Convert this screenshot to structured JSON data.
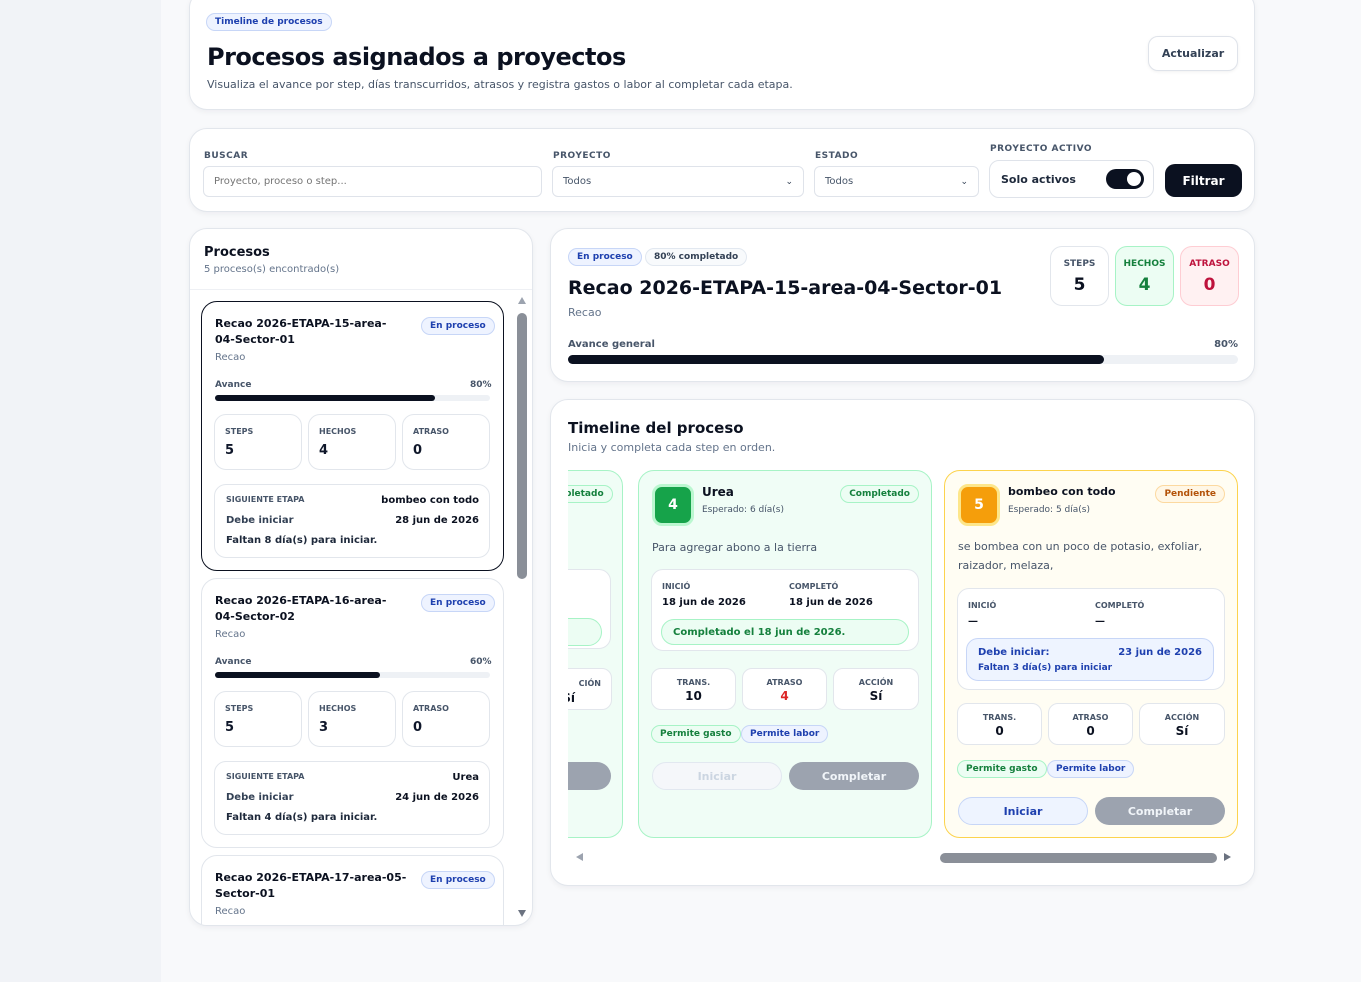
{
  "header": {
    "badge": "Timeline de procesos",
    "title": "Procesos asignados a proyectos",
    "subtitle": "Visualiza el avance por step, días transcurridos, atrasos y registra gastos o labor al completar cada etapa.",
    "refresh_label": "Actualizar"
  },
  "filters": {
    "search_label": "BUSCAR",
    "search_placeholder": "Proyecto, proceso o step...",
    "project_label": "PROYECTO",
    "project_value": "Todos",
    "state_label": "ESTADO",
    "state_value": "Todos",
    "active_label": "PROYECTO ACTIVO",
    "active_toggle_label": "Solo activos",
    "active_on": true,
    "filter_label": "Filtrar"
  },
  "process_list": {
    "title": "Procesos",
    "count_text": "5 proceso(s) encontrado(s)",
    "progress_label": "Avance",
    "next_label": "SIGUIENTE ETAPA",
    "must_start_label": "Debe iniciar",
    "stat_labels": {
      "steps": "STEPS",
      "done": "HECHOS",
      "delay": "ATRASO"
    },
    "items": [
      {
        "name": "Recao 2026-ETAPA-15-area-04-Sector-01",
        "status": "En proceso",
        "subtitle": "Recao",
        "progress_text": "80%",
        "progress": 0.8,
        "steps": "5",
        "done": "4",
        "delay": "0",
        "next_step": "bombeo con todo",
        "start_date": "28 jun de 2026",
        "remaining": "Faltan 8 día(s) para iniciar."
      },
      {
        "name": "Recao 2026-ETAPA-16-area-04-Sector-02",
        "status": "En proceso",
        "subtitle": "Recao",
        "progress_text": "60%",
        "progress": 0.6,
        "steps": "5",
        "done": "3",
        "delay": "0",
        "next_step": "Urea",
        "start_date": "24 jun de 2026",
        "remaining": "Faltan 4 día(s) para iniciar."
      },
      {
        "name": "Recao 2026-ETAPA-17-area-05-Sector-01",
        "status": "En proceso",
        "subtitle": "Recao"
      }
    ]
  },
  "detail": {
    "status_badge": "En proceso",
    "percent_badge": "80% completado",
    "title": "Recao 2026-ETAPA-15-area-04-Sector-01",
    "subtitle": "Recao",
    "progress_label": "Avance general",
    "progress_text": "80%",
    "progress": 0.8,
    "stats": {
      "steps_label": "STEPS",
      "steps": "5",
      "done_label": "HECHOS",
      "done": "4",
      "delay_label": "ATRASO",
      "delay": "0"
    }
  },
  "timeline": {
    "title": "Timeline del proceso",
    "subtitle": "Inicia y completa cada step en orden.",
    "partial_card": {
      "badge": "pletado",
      "label": "CIÓN",
      "value": "Sí",
      "button": "r"
    },
    "steps": [
      {
        "number": "4",
        "name": "Urea",
        "expected": "Esperado: 6 día(s)",
        "status": "Completado",
        "description": "Para agregar abono a la tierra",
        "started_label": "INICIÓ",
        "started": "18 jun de 2026",
        "completed_label": "COMPLETÓ",
        "completed": "18 jun de 2026",
        "note": "Completado el 18 jun de 2026.",
        "trans_label": "TRANS.",
        "trans": "10",
        "delay_label": "ATRASO",
        "delay": "4",
        "action_label": "ACCIÓN",
        "action": "Sí",
        "tag1": "Permite gasto",
        "tag2": "Permite labor",
        "start_button": "Iniciar",
        "complete_button": "Completar"
      },
      {
        "number": "5",
        "name": "bombeo con todo",
        "expected": "Esperado: 5 día(s)",
        "status": "Pendiente",
        "description": "se bombea con un poco de potasio, exfoliar, raizador, melaza,",
        "started_label": "INICIÓ",
        "started": "—",
        "completed_label": "COMPLETÓ",
        "completed": "—",
        "must_start_label": "Debe iniciar:",
        "must_start_date": "23 jun de 2026",
        "remaining": "Faltan 3 día(s) para iniciar",
        "trans_label": "TRANS.",
        "trans": "0",
        "delay_label": "ATRASO",
        "delay": "0",
        "action_label": "ACCIÓN",
        "action": "Sí",
        "tag1": "Permite gasto",
        "tag2": "Permite labor",
        "start_button": "Iniciar",
        "complete_button": "Completar"
      }
    ]
  },
  "colors": {
    "dark": "#0b1120",
    "green": "#16a34a",
    "orange": "#f59e0b",
    "red": "#dc2626",
    "blue": "#1e40af"
  }
}
